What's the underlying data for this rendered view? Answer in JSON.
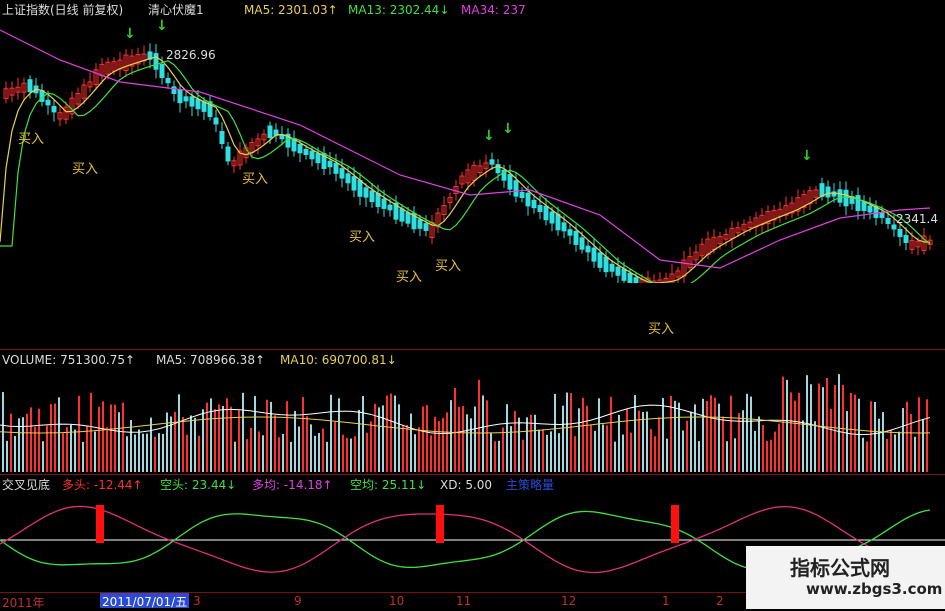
{
  "price_panel": {
    "title": "上证指数(日线 前复权)",
    "indicator": "清心伏魔1",
    "ma5_label": "MA5: 2301.03↑",
    "ma13_label": "MA13: 2302.44↓",
    "ma34_label": "MA34: 237",
    "high_marker": "2826.96",
    "last_price": "2341.4",
    "buy_labels": [
      "买入",
      "买入",
      "买入",
      "买入",
      "买入",
      "买入",
      "买入"
    ],
    "sell_arrows": [
      "↓",
      "↓",
      "↓",
      "↓",
      "↓"
    ],
    "colors": {
      "title": "#dcdcdc",
      "ma5": "#e8d050",
      "ma13": "#40e040",
      "ma34": "#e040e0",
      "up": "#ff3030",
      "down": "#30e0e0"
    }
  },
  "volume_panel": {
    "title": "VOLUME: 751300.75↑",
    "ma5_label": "MA5: 708966.38↑",
    "ma10_label": "MA10: 690700.81↓"
  },
  "cross_panel": {
    "title": "交叉见底",
    "duotou": "多头: -12.44↑",
    "kongtou": "空头: 23.44↓",
    "duojun": "多均: -14.18↑",
    "kongjun": "空均: 25.11↓",
    "xd": "XD: 5.00",
    "extra": "主策略量"
  },
  "time_axis": {
    "labels": [
      "2011年",
      "2011/07/01/五",
      "3",
      "9",
      "10",
      "11",
      "12",
      "1",
      "2"
    ]
  },
  "watermark": {
    "line1": "指标公式网",
    "line2": "www.zbgs3.com"
  }
}
